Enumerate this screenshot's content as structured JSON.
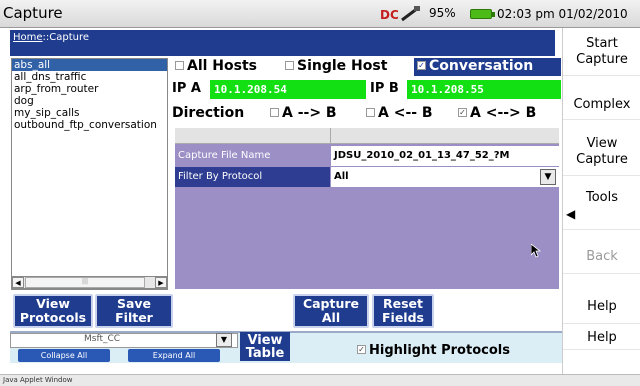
{
  "titlebar": {
    "title": "Capture",
    "battery": "95%",
    "datetime": "02:03 pm 01/02/2010"
  },
  "breadcrumb": {
    "home": "Home",
    "separator": "::",
    "current": "Capture"
  },
  "filter_list": {
    "items": [
      "abs_all",
      "all_dns_traffic",
      "arp_from_router",
      "dog",
      "my_sip_calls",
      "outbound_ftp_conversation"
    ],
    "selected": "abs_all"
  },
  "modes": {
    "all_hosts": "All Hosts",
    "single_host": "Single Host",
    "conversation": "Conversation",
    "selected": "Conversation"
  },
  "ip": {
    "a_label": "IP A",
    "a_value": "10.1.208.54",
    "b_label": "IP B",
    "b_value": "10.1.208.55"
  },
  "direction": {
    "label": "Direction",
    "options": [
      "A --> B",
      "A <-- B",
      "A <--> B"
    ],
    "selected": "A <--> B"
  },
  "settings_table": {
    "rows": [
      {
        "name": "Capture File Name",
        "value": "JDSU_2010_02_01_13_47_52_?M"
      },
      {
        "name": "Filter By Protocol",
        "value": "All"
      }
    ]
  },
  "action_buttons": {
    "view_protocols": [
      "View",
      "Protocols"
    ],
    "save_filter": [
      "Save",
      "Filter"
    ],
    "capture_all": [
      "Capture",
      "All"
    ],
    "reset_fields": [
      "Reset",
      "Fields"
    ]
  },
  "right_panel": {
    "start_capture": [
      "Start",
      "Capture"
    ],
    "complex": "Complex",
    "view_capture": [
      "View",
      "Capture"
    ],
    "tools": "Tools",
    "back": "Back",
    "help": "Help",
    "help_bottom": "Help"
  },
  "lower_strip": {
    "tree_partial": "Msft_CC",
    "collapse_all": "Collapse All",
    "expand_all": "Expand All",
    "view_table": [
      "View",
      "Table"
    ],
    "highlight_protocols": "Highlight Protocols"
  },
  "status": {
    "text": "Java Applet Window"
  },
  "colors": {
    "accent": "#1f3c8f",
    "ip_field": "#12e012",
    "table_bg": "#9b8fc6"
  }
}
